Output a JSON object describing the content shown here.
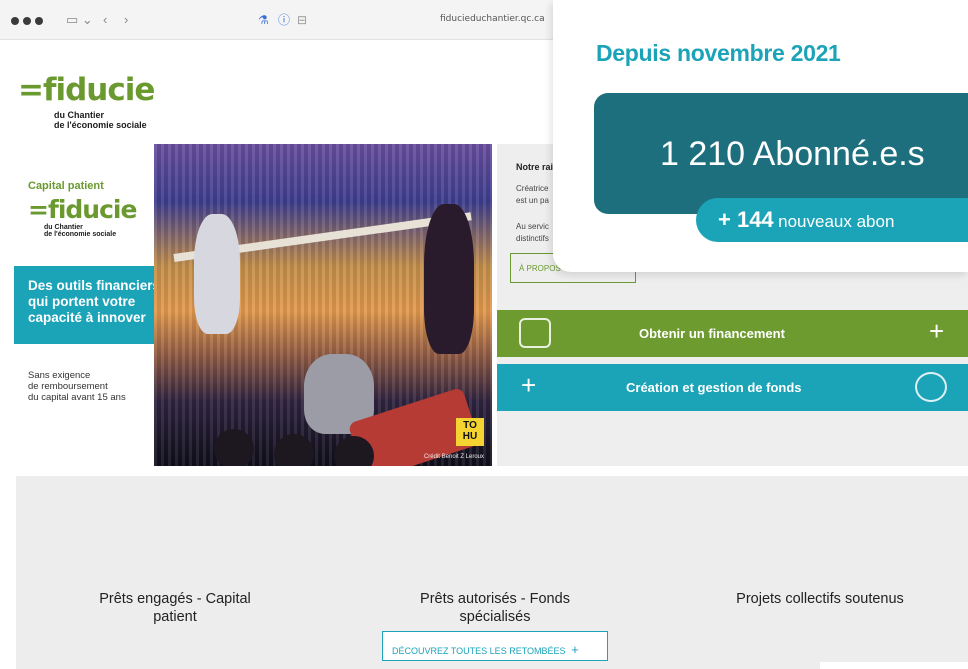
{
  "browser": {
    "url": "fiducieduchantier.qc.ca",
    "sidebar_icon": "sidebar-icon",
    "back_icon": "back-icon",
    "forward_icon": "forward-icon"
  },
  "header_logo": {
    "name": "=fiducie",
    "sub_line1": "du Chantier",
    "sub_line2": "de l'économie sociale"
  },
  "hero_left": {
    "label": "Capital patient",
    "logo_name": "=fiducie",
    "logo_sub1": "du Chantier",
    "logo_sub2": "de l'économie sociale",
    "tagline_lines": [
      "Des outils financiers",
      "qui portent votre",
      "capacité à innover"
    ],
    "note_lines": [
      "Sans exigence",
      "de remboursement",
      "du capital avant 15 ans"
    ]
  },
  "photo": {
    "badge_line1": "TO",
    "badge_line2": "HU",
    "credit": "Crédit Benoit Z Leroux"
  },
  "right_panel": {
    "heading": "Notre rai",
    "para1_line1": "Créatrice",
    "para1_line2": "est un pa",
    "para2_line1": "Au servic",
    "para2_line2": "distinctifs",
    "apropos_label": "À PROPOS"
  },
  "actions": {
    "financement_label": "Obtenir un financement",
    "fonds_label": "Création et gestion de fonds"
  },
  "stats": {
    "col1_line1": "Prêts engagés - Capital",
    "col1_line2": "patient",
    "col2_line1": "Prêts autorisés - Fonds",
    "col2_line2": "spécialisés",
    "col3_line1": "Projets collectifs soutenus",
    "cta_label": "DÉCOUVREZ TOUTES LES RETOMBÉES"
  },
  "overlay": {
    "title": "Depuis novembre 2021",
    "subscribers": "1 210 Abonné.e.s",
    "new_count": "+ 144",
    "new_label": "nouveaux abon"
  },
  "colors": {
    "brand_green": "#6a9a2f",
    "brand_teal": "#1ba3b8",
    "dark_teal": "#1d6f7e"
  }
}
